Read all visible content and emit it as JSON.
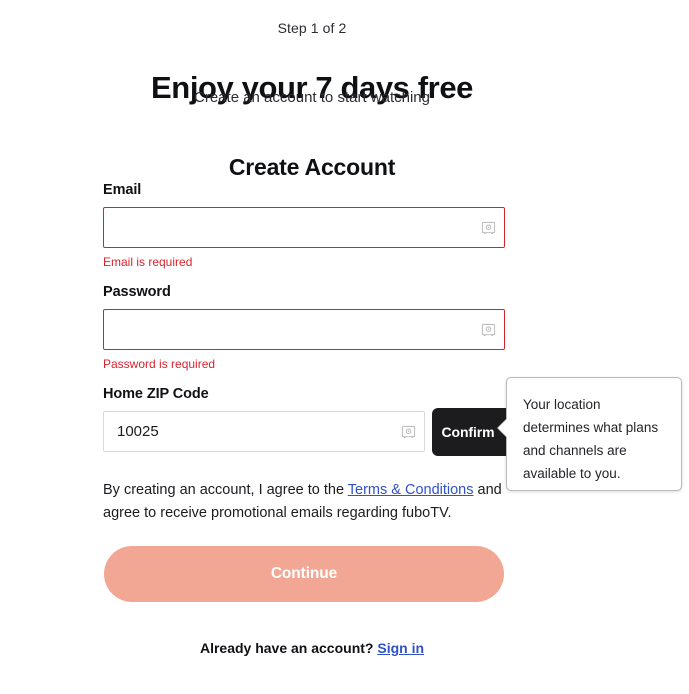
{
  "header": {
    "step_label": "Step 1 of 2",
    "title": "Enjoy your 7 days free",
    "subtitle": "Create an account to start watching"
  },
  "form": {
    "card_title": "Create Account",
    "fields": [
      {
        "id": "email",
        "label": "Email",
        "value": "",
        "placeholder": "",
        "error": "Email is required",
        "icon": "password-vault-icon"
      },
      {
        "id": "password",
        "label": "Password",
        "value": "",
        "placeholder": "",
        "error": "Password is required",
        "icon": "password-vault-icon"
      },
      {
        "id": "zip",
        "label": "Home ZIP Code",
        "value": "10025",
        "placeholder": "",
        "error": "",
        "icon": "password-vault-icon"
      }
    ],
    "confirm_label": "Confirm"
  },
  "tooltip": {
    "text": "Your location determines what plans and channels are available to you."
  },
  "terms": {
    "prefix": "By creating an account, I agree to the ",
    "link": "Terms & Conditions",
    "suffix": " and agree to receive promotional emails regarding fuboTV."
  },
  "actions": {
    "continue_label": "Continue"
  },
  "footer": {
    "prompt": "Already have an account? ",
    "signin_label": "Sign in"
  },
  "colors": {
    "error_red": "#d9232e",
    "input_error_border": "#d6232a",
    "continue_bg": "#f2a795",
    "link_blue": "#2f51c9",
    "confirm_bg": "#1c1c1e"
  }
}
